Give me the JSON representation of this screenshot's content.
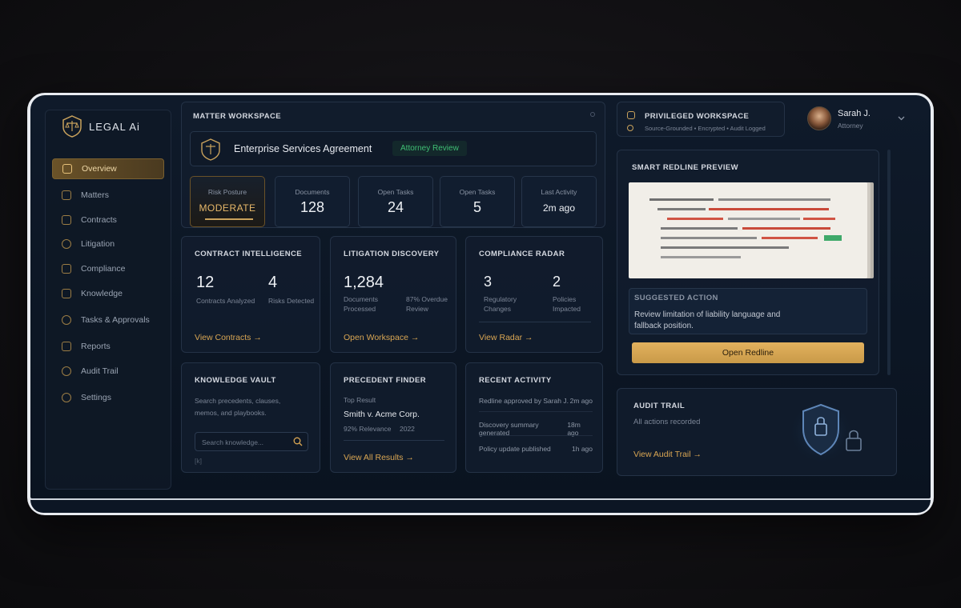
{
  "brand": {
    "name": "LEGAL Ai"
  },
  "sidebar": {
    "items": [
      {
        "label": "Overview",
        "icon": "overview-icon",
        "active": true
      },
      {
        "label": "Matters",
        "icon": "matters-icon"
      },
      {
        "label": "Contracts",
        "icon": "contracts-icon"
      },
      {
        "label": "Litigation",
        "icon": "litigation-icon"
      },
      {
        "label": "Compliance",
        "icon": "compliance-icon"
      },
      {
        "label": "Knowledge",
        "icon": "knowledge-icon"
      },
      {
        "label": "Tasks & Approvals",
        "icon": "tasks-icon"
      },
      {
        "label": "Reports",
        "icon": "reports-icon"
      },
      {
        "label": "Audit Trail",
        "icon": "audit-icon"
      },
      {
        "label": "Settings",
        "icon": "settings-icon"
      }
    ]
  },
  "workspace": {
    "title": "MATTER WORKSPACE",
    "matter_name": "Enterprise Services Agreement",
    "status_badge": "Attorney Review",
    "stats": [
      {
        "label": "Risk Posture",
        "value": "MODERATE"
      },
      {
        "label": "Documents",
        "value": "128"
      },
      {
        "label": "Open Tasks",
        "value": "24"
      },
      {
        "label": "Open Tasks",
        "value": "5"
      },
      {
        "label": "Last Activity",
        "value": "2m ago"
      }
    ]
  },
  "contract_intel": {
    "title": "CONTRACT INTELLIGENCE",
    "metric1_value": "12",
    "metric1_label": "Contracts Analyzed",
    "metric2_value": "4",
    "metric2_label": "Risks Detected",
    "link": "View Contracts →"
  },
  "litigation": {
    "title": "LITIGATION DISCOVERY",
    "metric_value": "1,284",
    "metric_label": "Documents Processed",
    "side_label": "87% Overdue Review",
    "link": "Open Workspace →"
  },
  "compliance": {
    "title": "COMPLIANCE RADAR",
    "metric1_value": "3",
    "metric1_label": "Regulatory Changes",
    "metric2_value": "2",
    "metric2_label": "Policies Impacted",
    "link": "View Radar →"
  },
  "knowledge": {
    "title": "KNOWLEDGE VAULT",
    "description": "Search precedents, clauses, memos, and playbooks.",
    "search_placeholder": "Search knowledge...",
    "footnote": "[k]"
  },
  "precedent": {
    "title": "PRECEDENT FINDER",
    "top_label": "Top Result",
    "result_name": "Smith v. Acme Corp.",
    "relevance": "92% Relevance",
    "year": "2022",
    "link": "View All Results →"
  },
  "activity": {
    "title": "RECENT ACTIVITY",
    "items": [
      {
        "text": "Redline approved by Sarah J.",
        "time": "2m ago"
      },
      {
        "text": "Discovery summary generated",
        "time": "18m ago"
      },
      {
        "text": "Policy update published",
        "time": "1h ago"
      }
    ]
  },
  "privileged": {
    "title": "PRIVILEGED WORKSPACE",
    "tags": "Source-Grounded • Encrypted • Audit Logged"
  },
  "user": {
    "name": "Sarah J.",
    "role": "Attorney"
  },
  "redline": {
    "title": "SMART REDLINE PREVIEW",
    "suggested_title": "SUGGESTED ACTION",
    "suggested_text": "Review limitation of liability language and fallback position.",
    "button": "Open Redline"
  },
  "audit": {
    "title": "AUDIT TRAIL",
    "subtitle": "All actions recorded",
    "link": "View Audit Trail →"
  },
  "colors": {
    "accent": "#d9a653",
    "risk": "#e07a48",
    "badge": "#3fbf74",
    "bg": "#0f1a2a"
  }
}
